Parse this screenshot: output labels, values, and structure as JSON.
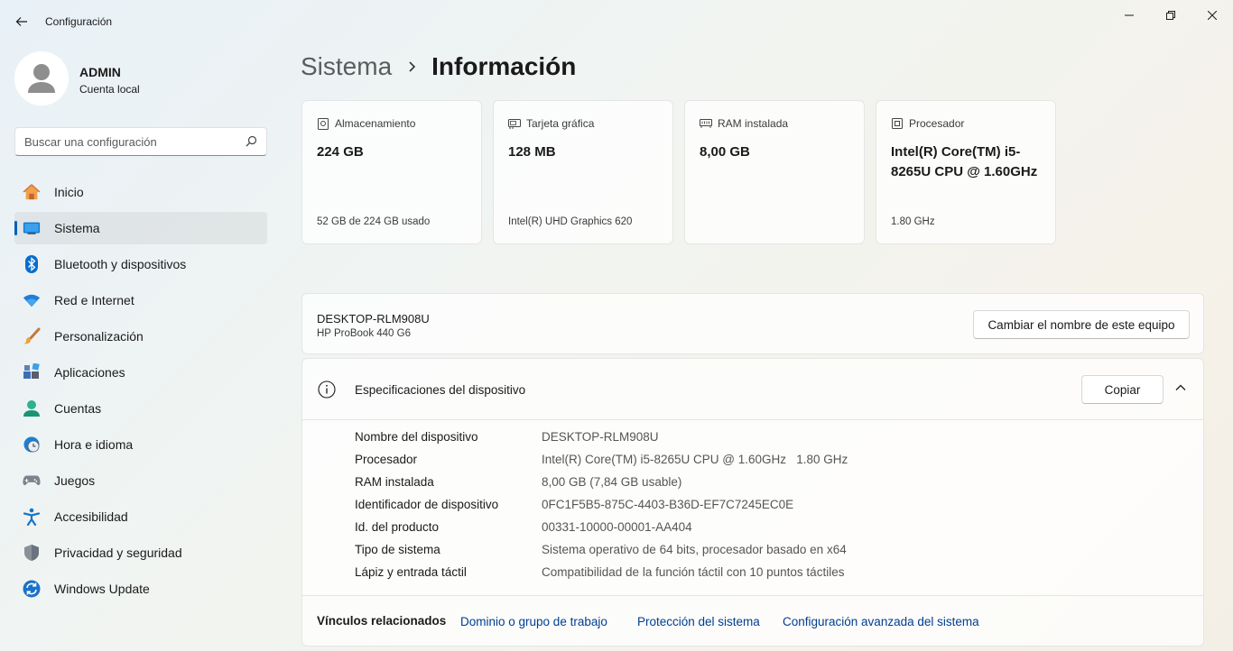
{
  "window": {
    "title": "Configuración"
  },
  "user": {
    "name": "ADMIN",
    "account_type": "Cuenta local"
  },
  "search": {
    "placeholder": "Buscar una configuración"
  },
  "sidebar": {
    "items": [
      {
        "label": "Inicio",
        "icon": "home-icon"
      },
      {
        "label": "Sistema",
        "icon": "system-icon",
        "active": true
      },
      {
        "label": "Bluetooth y dispositivos",
        "icon": "bluetooth-icon"
      },
      {
        "label": "Red e Internet",
        "icon": "wifi-icon"
      },
      {
        "label": "Personalización",
        "icon": "brush-icon"
      },
      {
        "label": "Aplicaciones",
        "icon": "apps-icon"
      },
      {
        "label": "Cuentas",
        "icon": "accounts-icon"
      },
      {
        "label": "Hora e idioma",
        "icon": "clock-globe-icon"
      },
      {
        "label": "Juegos",
        "icon": "gamepad-icon"
      },
      {
        "label": "Accesibilidad",
        "icon": "accessibility-icon"
      },
      {
        "label": "Privacidad y seguridad",
        "icon": "shield-icon"
      },
      {
        "label": "Windows Update",
        "icon": "update-icon"
      }
    ]
  },
  "breadcrumb": {
    "parent": "Sistema",
    "current": "Información"
  },
  "cards": [
    {
      "title": "Almacenamiento",
      "value": "224 GB",
      "sub": "52 GB de 224 GB usado",
      "icon": "storage-icon"
    },
    {
      "title": "Tarjeta gráfica",
      "value": "128 MB",
      "sub": "Intel(R) UHD Graphics 620",
      "icon": "gpu-icon"
    },
    {
      "title": "RAM instalada",
      "value": "8,00 GB",
      "sub": "",
      "icon": "ram-icon"
    },
    {
      "title": "Procesador",
      "value": "Intel(R) Core(TM) i5-8265U CPU @ 1.60GHz",
      "sub": "1.80 GHz",
      "icon": "cpu-icon"
    }
  ],
  "device": {
    "name": "DESKTOP-RLM908U",
    "model": "HP ProBook 440 G6",
    "rename_label": "Cambiar el nombre de este equipo"
  },
  "specs": {
    "title": "Especificaciones del dispositivo",
    "copy_label": "Copiar",
    "rows": [
      {
        "label": "Nombre del dispositivo",
        "value": "DESKTOP-RLM908U"
      },
      {
        "label": "Procesador",
        "value": "Intel(R) Core(TM) i5-8265U CPU @ 1.60GHz   1.80 GHz"
      },
      {
        "label": "RAM instalada",
        "value": "8,00 GB (7,84 GB usable)"
      },
      {
        "label": "Identificador de dispositivo",
        "value": "0FC1F5B5-875C-4403-B36D-EF7C7245EC0E"
      },
      {
        "label": "Id. del producto",
        "value": "00331-10000-00001-AA404"
      },
      {
        "label": "Tipo de sistema",
        "value": "Sistema operativo de 64 bits, procesador basado en x64"
      },
      {
        "label": "Lápiz y entrada táctil",
        "value": "Compatibilidad de la función táctil con 10 puntos táctiles"
      }
    ]
  },
  "related": {
    "title": "Vínculos relacionados",
    "links": [
      "Dominio o grupo de trabajo",
      "Protección del sistema",
      "Configuración avanzada del sistema"
    ]
  },
  "colors": {
    "accent": "#005fb8",
    "link": "#003e92"
  }
}
